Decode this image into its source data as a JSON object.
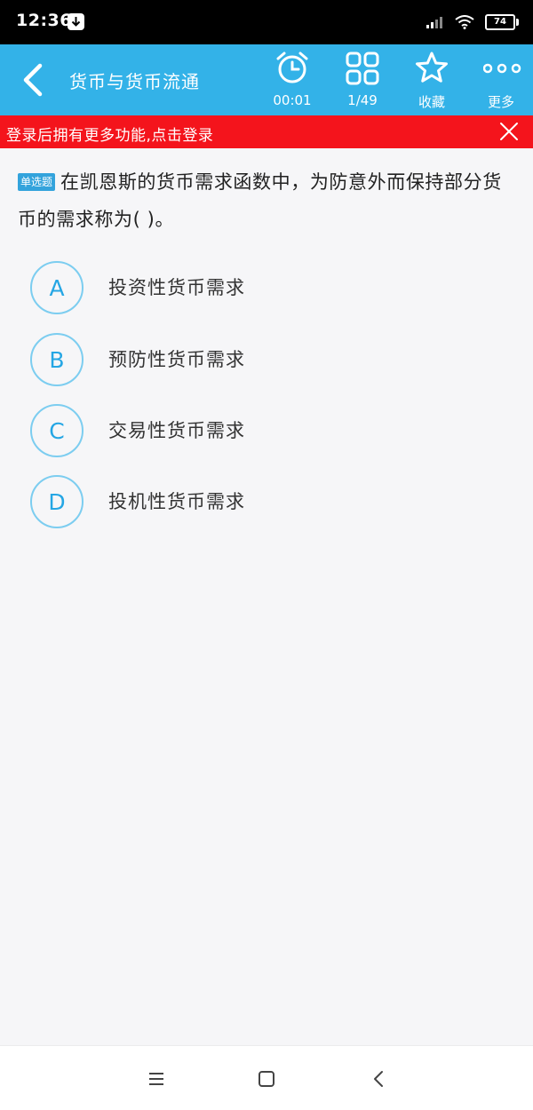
{
  "status_bar": {
    "time": "12:36",
    "battery": "74"
  },
  "app_bar": {
    "title": "货币与货币流通",
    "timer": "00:01",
    "progress": "1/49",
    "favorite_label": "收藏",
    "more_label": "更多"
  },
  "banner": {
    "text": "登录后拥有更多功能,点击登录"
  },
  "question": {
    "type_tag": "单选题",
    "text": "在凯恩斯的货币需求函数中，为防意外而保持部分货币的需求称为(   )。"
  },
  "options": [
    {
      "letter": "A",
      "text": "投资性货币需求"
    },
    {
      "letter": "B",
      "text": "预防性货币需求"
    },
    {
      "letter": "C",
      "text": "交易性货币需求"
    },
    {
      "letter": "D",
      "text": "投机性货币需求"
    }
  ],
  "colors": {
    "primary": "#33b2e8",
    "banner": "#f4141c",
    "option_ring": "#7ccdf0",
    "option_letter": "#25a6e4"
  }
}
